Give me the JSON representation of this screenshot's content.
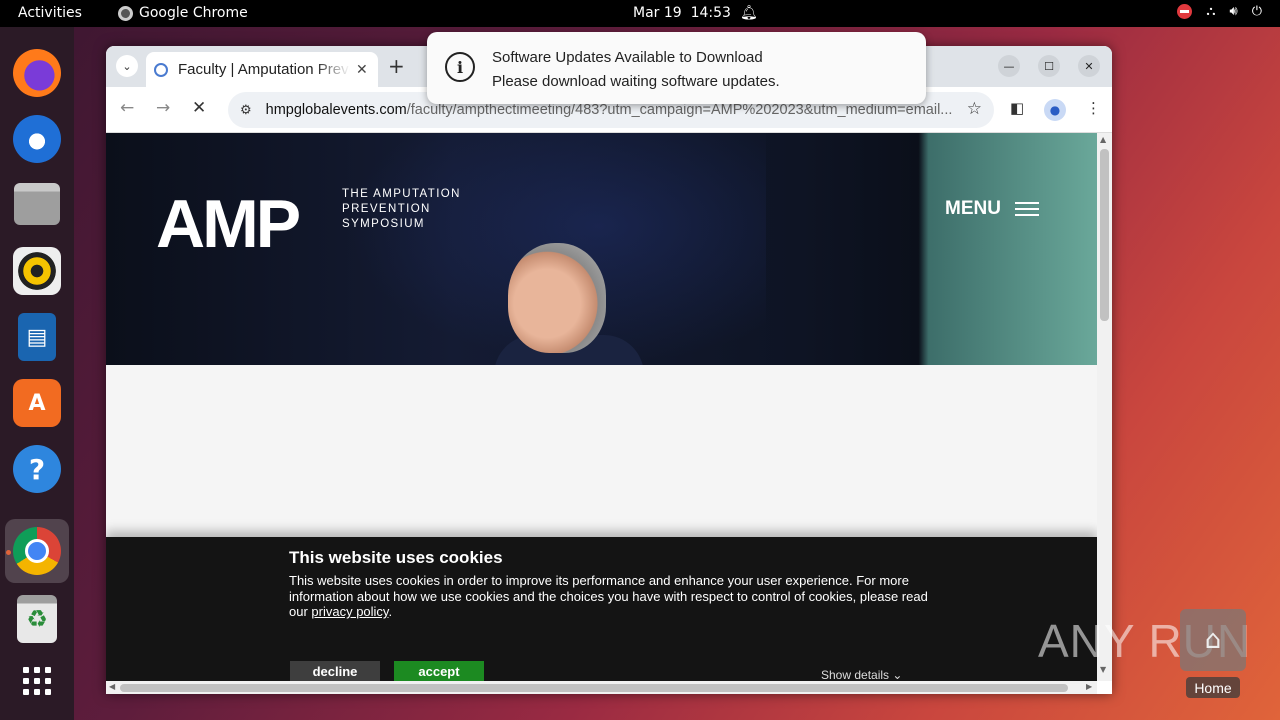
{
  "topbar": {
    "activities": "Activities",
    "app_name": "Google Chrome",
    "date": "Mar 19",
    "time": "14:53"
  },
  "dock": {
    "items": [
      "firefox-icon",
      "thunderbird-icon",
      "files-icon",
      "rhythmbox-icon",
      "libreoffice-writer-icon",
      "app-center-icon",
      "help-icon",
      "chrome-icon",
      "trash-icon",
      "app-grid-icon"
    ]
  },
  "browser": {
    "tab_title": "Faculty | Amputation Prevention Symposium",
    "url_host": "hmpglobalevents.com",
    "url_path": "/faculty/ampthectimeeting/483?utm_campaign=AMP%202023&utm_medium=email..."
  },
  "notification": {
    "title": "Software Updates Available to Download",
    "body": "Please download waiting software updates."
  },
  "page": {
    "logo": "AMP",
    "tagline_line1": "THE AMPUTATION",
    "tagline_line2": "PREVENTION",
    "tagline_line3": "SYMPOSIUM",
    "menu_label": "MENU",
    "cookie": {
      "title": "This website uses cookies",
      "text": "This website uses cookies in order to improve its performance and enhance your user experience. For more information about how we use cookies and the choices you have with respect to control of cookies, please read our ",
      "link": "privacy policy",
      "period": ".",
      "decline": "decline",
      "accept": "accept",
      "details": "Show details"
    }
  },
  "watermark": "ANY RUN",
  "desktop": {
    "home_label": "Home"
  },
  "colors": {
    "accept_green": "#1c8a21",
    "cookie_bg": "#141414",
    "topbar_bg": "#000000"
  }
}
